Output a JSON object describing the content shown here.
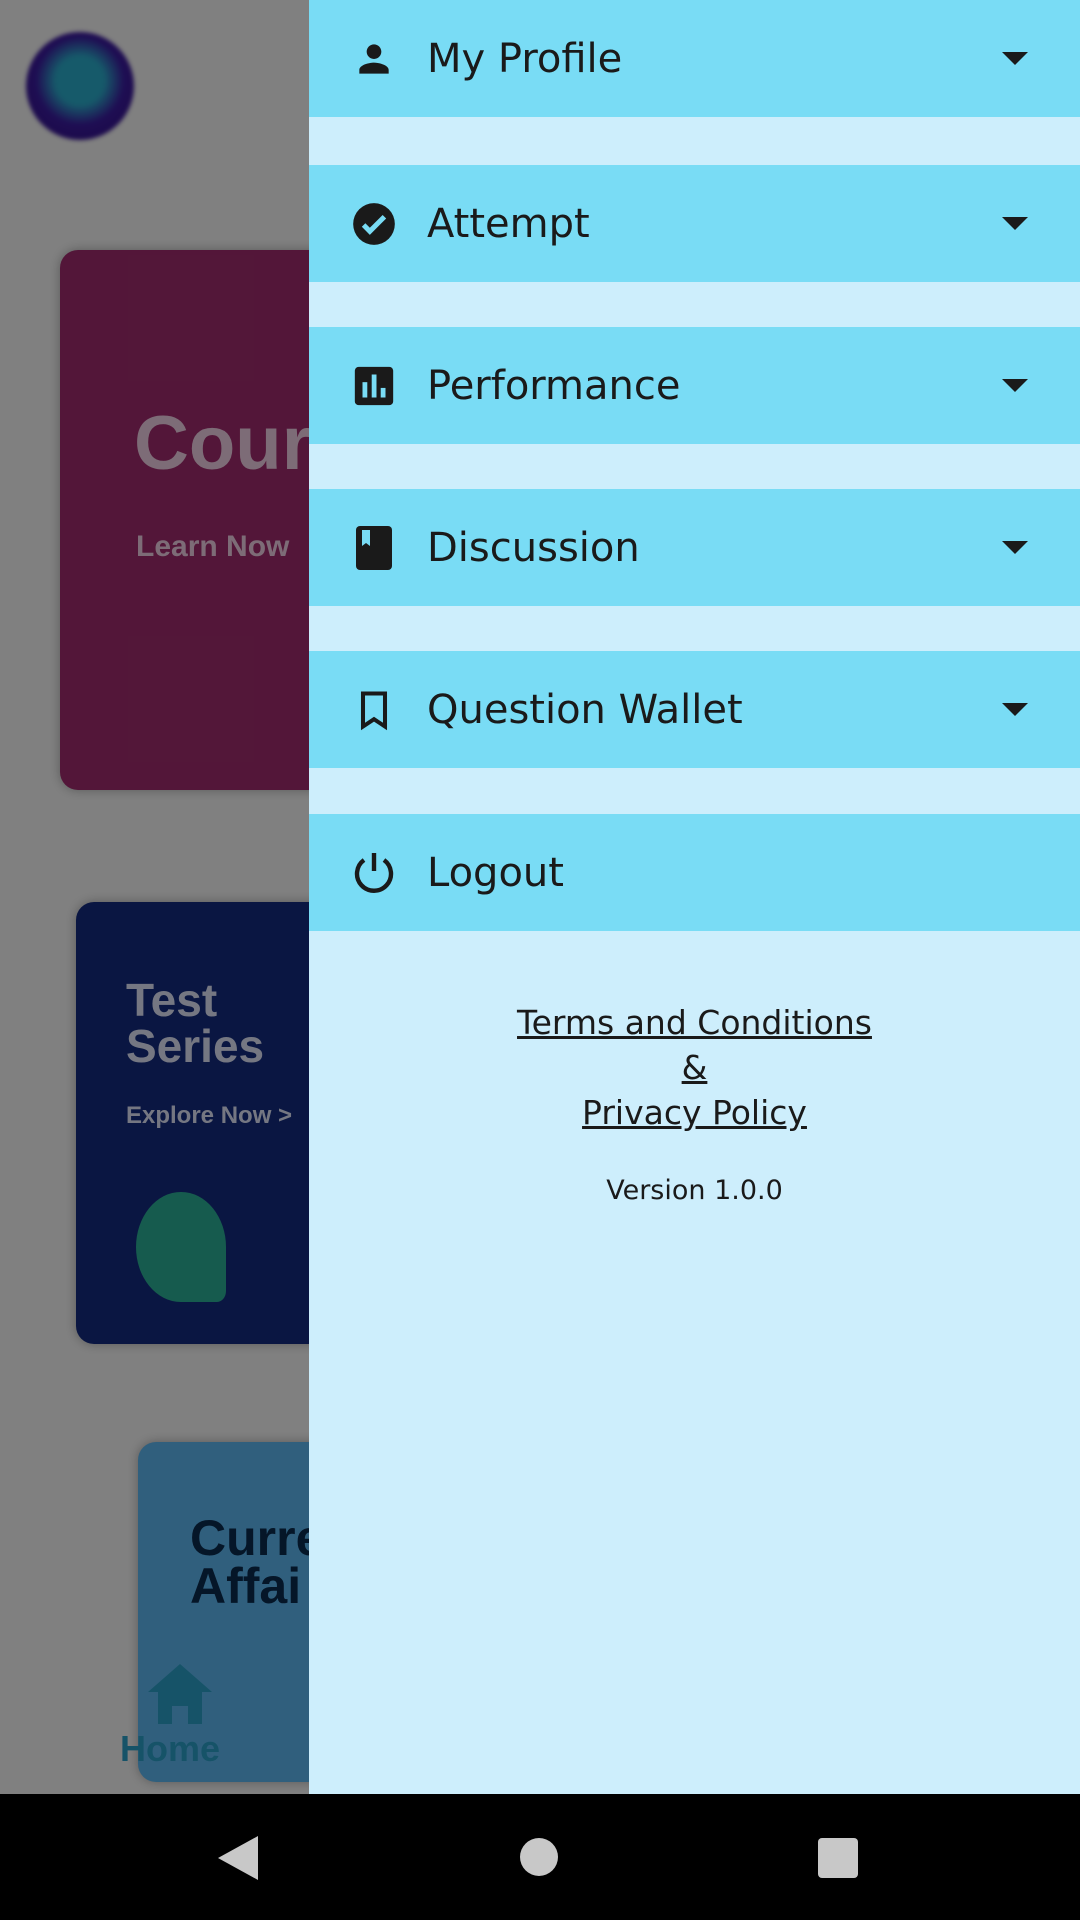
{
  "background": {
    "cards": [
      {
        "title": "Cours",
        "subtitle": "Learn Now"
      },
      {
        "title": "Test Series",
        "subtitle": "Explore Now >"
      },
      {
        "title": "Curre Affai"
      }
    ],
    "bottom_nav": {
      "home_label": "Home"
    }
  },
  "drawer": {
    "items": [
      {
        "label": "My Profile",
        "icon": "person-icon",
        "expandable": true
      },
      {
        "label": "Attempt",
        "icon": "check-circle-icon",
        "expandable": true
      },
      {
        "label": "Performance",
        "icon": "bar-chart-icon",
        "expandable": true
      },
      {
        "label": "Discussion",
        "icon": "book-icon",
        "expandable": true
      },
      {
        "label": "Question Wallet",
        "icon": "bookmark-icon",
        "expandable": true
      },
      {
        "label": "Logout",
        "icon": "power-icon",
        "expandable": false
      }
    ],
    "terms_label": "Terms and Conditions",
    "ampersand": "&",
    "privacy_label": "Privacy Policy",
    "version": "Version 1.0.0"
  },
  "colors": {
    "row": "#79dcf5",
    "drawer_bg": "#cdeefc"
  }
}
